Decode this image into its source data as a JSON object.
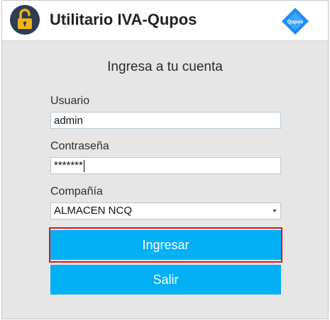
{
  "app": {
    "title": "Utilitario IVA-Qupos",
    "logo_text": "Qupos"
  },
  "login": {
    "heading": "Ingresa a tu cuenta",
    "user_label": "Usuario",
    "user_value": "admin",
    "password_label": "Contraseña",
    "password_value": "*******",
    "company_label": "Compañía",
    "company_value": "ALMACEN NCQ",
    "submit_label": "Ingresar",
    "exit_label": "Salir"
  },
  "colors": {
    "accent": "#03aff5",
    "highlight": "#e0161f",
    "lock": "#f0b31a",
    "lock_bg": "#2d3e50",
    "brand": "#1f8bf3"
  },
  "icons": [
    "lock-icon",
    "qupos-logo",
    "chevron-down-icon"
  ]
}
